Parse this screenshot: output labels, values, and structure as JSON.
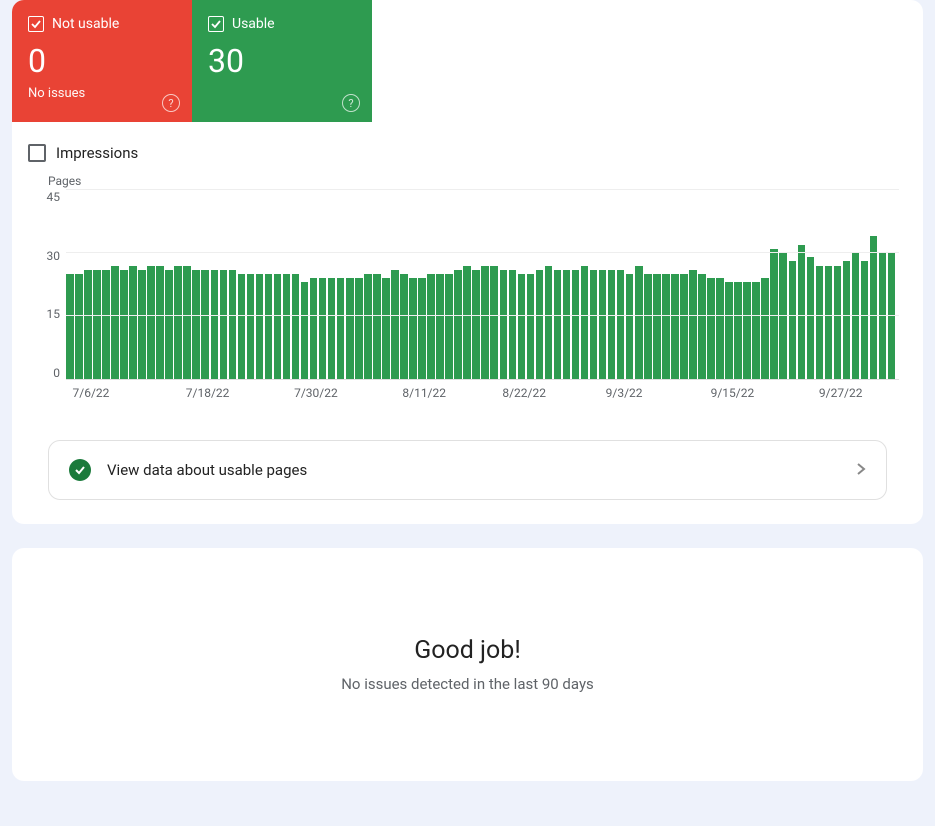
{
  "cards": {
    "not_usable": {
      "label": "Not usable",
      "value": "0",
      "sub": "No issues"
    },
    "usable": {
      "label": "Usable",
      "value": "30"
    }
  },
  "impressions_label": "Impressions",
  "chart_axis_title": "Pages",
  "view_data_label": "View data about usable pages",
  "good_job": {
    "title": "Good job!",
    "sub": "No issues detected in the last 90 days"
  },
  "chart_data": {
    "type": "bar",
    "title": "Pages",
    "xlabel": "",
    "ylabel": "Pages",
    "ylim": [
      0,
      45
    ],
    "y_ticks": [
      45,
      30,
      15,
      0
    ],
    "x_tick_labels": [
      "7/6/22",
      "7/18/22",
      "7/30/22",
      "8/11/22",
      "8/22/22",
      "9/3/22",
      "9/15/22",
      "9/27/22"
    ],
    "x_tick_positions_pct": [
      3,
      17,
      30,
      43,
      55,
      67,
      80,
      93
    ],
    "categories_start": "7/6/22",
    "categories_end": "10/3/22",
    "values": [
      25,
      25,
      26,
      26,
      26,
      27,
      26,
      27,
      26,
      27,
      27,
      26,
      27,
      27,
      26,
      26,
      26,
      26,
      26,
      25,
      25,
      25,
      25,
      25,
      25,
      25,
      23,
      24,
      24,
      24,
      24,
      24,
      24,
      25,
      25,
      24,
      26,
      25,
      24,
      24,
      25,
      25,
      25,
      26,
      27,
      26,
      27,
      27,
      26,
      26,
      25,
      25,
      26,
      27,
      26,
      26,
      26,
      27,
      26,
      26,
      26,
      26,
      25,
      27,
      25,
      25,
      25,
      25,
      25,
      26,
      25,
      24,
      24,
      23,
      23,
      23,
      23,
      24,
      31,
      30,
      28,
      32,
      29,
      27,
      27,
      27,
      28,
      30,
      28,
      34,
      30,
      30
    ]
  }
}
